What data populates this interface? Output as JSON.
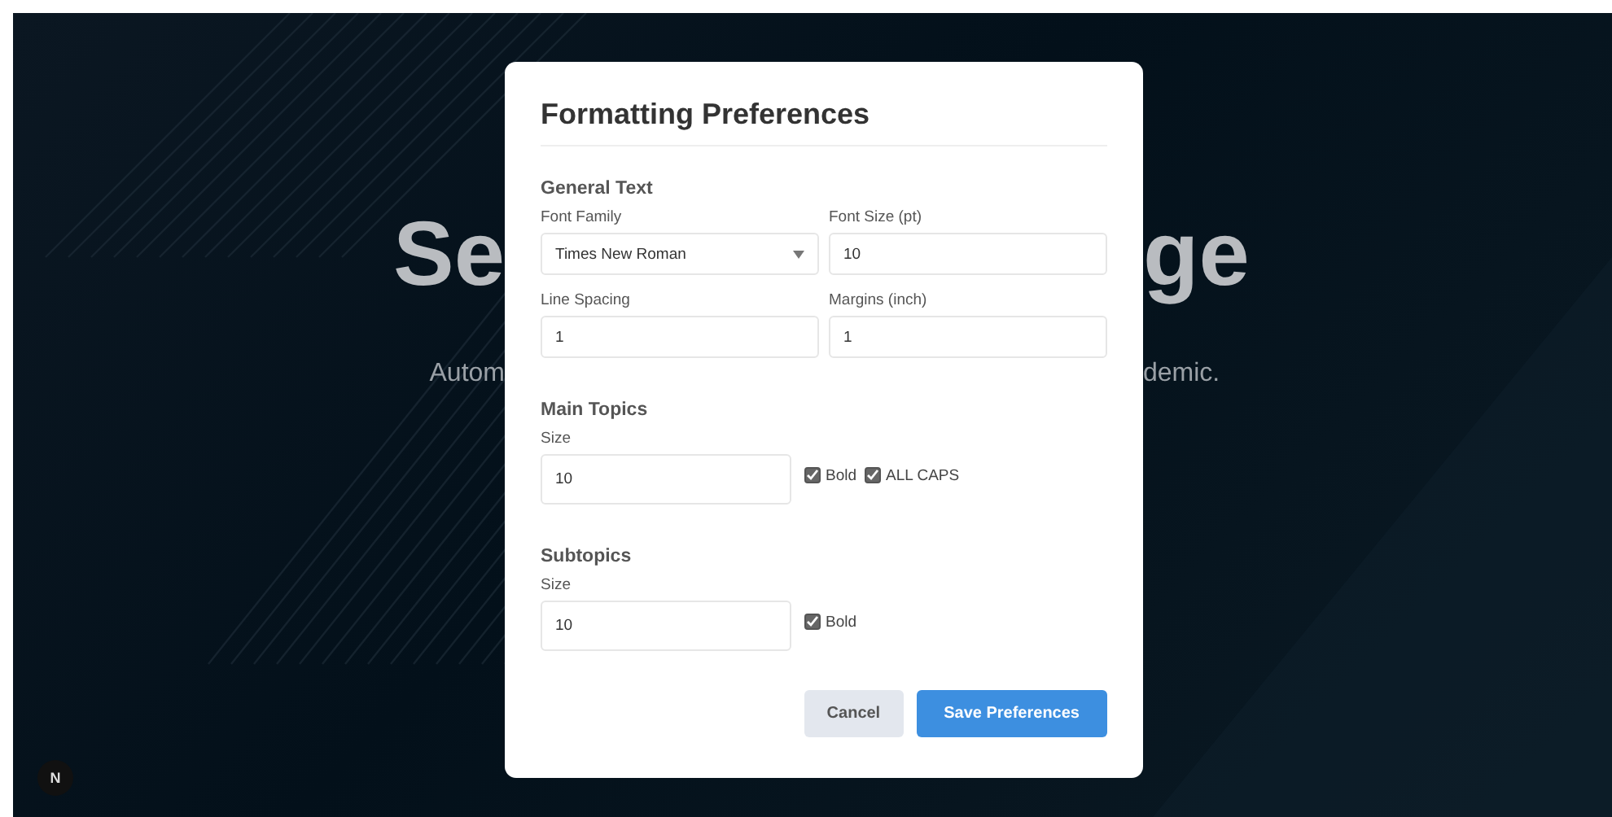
{
  "background": {
    "heading_left": "Se",
    "heading_right": "ge",
    "subtitle_left": "Autom",
    "subtitle_right": "demic.",
    "badge": "N"
  },
  "dialog": {
    "title": "Formatting Preferences",
    "sections": [
      {
        "heading": "General Text",
        "fields": [
          {
            "kind": "select",
            "label": "Font Family",
            "value": "Times New Roman"
          },
          {
            "kind": "input",
            "label": "Font Size (pt)",
            "value": "10"
          },
          {
            "kind": "input",
            "label": "Line Spacing",
            "value": "1"
          },
          {
            "kind": "input",
            "label": "Margins (inch)",
            "value": "1"
          }
        ]
      },
      {
        "heading": "Main Topics",
        "fields": [
          {
            "kind": "input",
            "label": "Size",
            "value": "10"
          }
        ],
        "options": [
          {
            "label": "Bold",
            "checked": true
          },
          {
            "label": "ALL CAPS",
            "checked": true
          }
        ]
      },
      {
        "heading": "Subtopics",
        "fields": [
          {
            "kind": "input",
            "label": "Size",
            "value": "10"
          }
        ],
        "options": [
          {
            "label": "Bold",
            "checked": true
          }
        ]
      }
    ],
    "buttons": [
      {
        "kind": "secondary",
        "label": "Cancel"
      },
      {
        "kind": "primary",
        "label": "Save Preferences"
      }
    ]
  }
}
